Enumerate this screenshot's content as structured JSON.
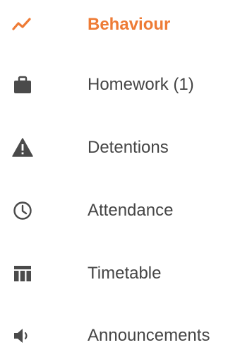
{
  "colors": {
    "active": "#ee7b35",
    "text": "#454545",
    "icon": "#4a4a4a"
  },
  "nav": {
    "items": [
      {
        "label": "Behaviour",
        "icon": "trend-line-icon",
        "active": true
      },
      {
        "label": "Homework (1)",
        "icon": "briefcase-icon",
        "active": false
      },
      {
        "label": "Detentions",
        "icon": "warning-icon",
        "active": false
      },
      {
        "label": "Attendance",
        "icon": "clock-icon",
        "active": false
      },
      {
        "label": "Timetable",
        "icon": "table-icon",
        "active": false
      },
      {
        "label": "Announcements",
        "icon": "speaker-icon",
        "active": false
      }
    ]
  }
}
